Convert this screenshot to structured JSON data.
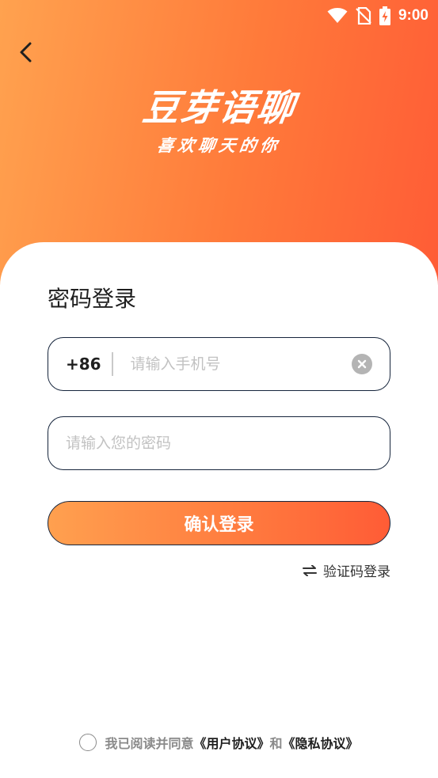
{
  "status_bar": {
    "time": "9:00",
    "icons": [
      "wifi-icon",
      "no-sim-icon",
      "battery-charging-icon"
    ]
  },
  "header": {
    "back_icon": "chevron-left-icon",
    "logo_title": "豆芽语聊",
    "logo_subtitle": "喜欢聊天的你"
  },
  "form": {
    "title": "密码登录",
    "country_code": "+86",
    "phone_placeholder": "请输入手机号",
    "phone_value": "",
    "password_placeholder": "请输入您的密码",
    "password_value": "",
    "submit_label": "确认登录",
    "switch_label": "验证码登录",
    "switch_icon": "swap-arrows-icon"
  },
  "agreement": {
    "prefix": "我已阅读并同意",
    "user_agreement": "《用户协议》",
    "conjunction": "和",
    "privacy_policy": "《隐私协议》"
  },
  "colors": {
    "gradient_start": "#ffa24f",
    "gradient_end": "#ff5c36",
    "border": "#16253c",
    "placeholder": "#c2c2c2"
  }
}
